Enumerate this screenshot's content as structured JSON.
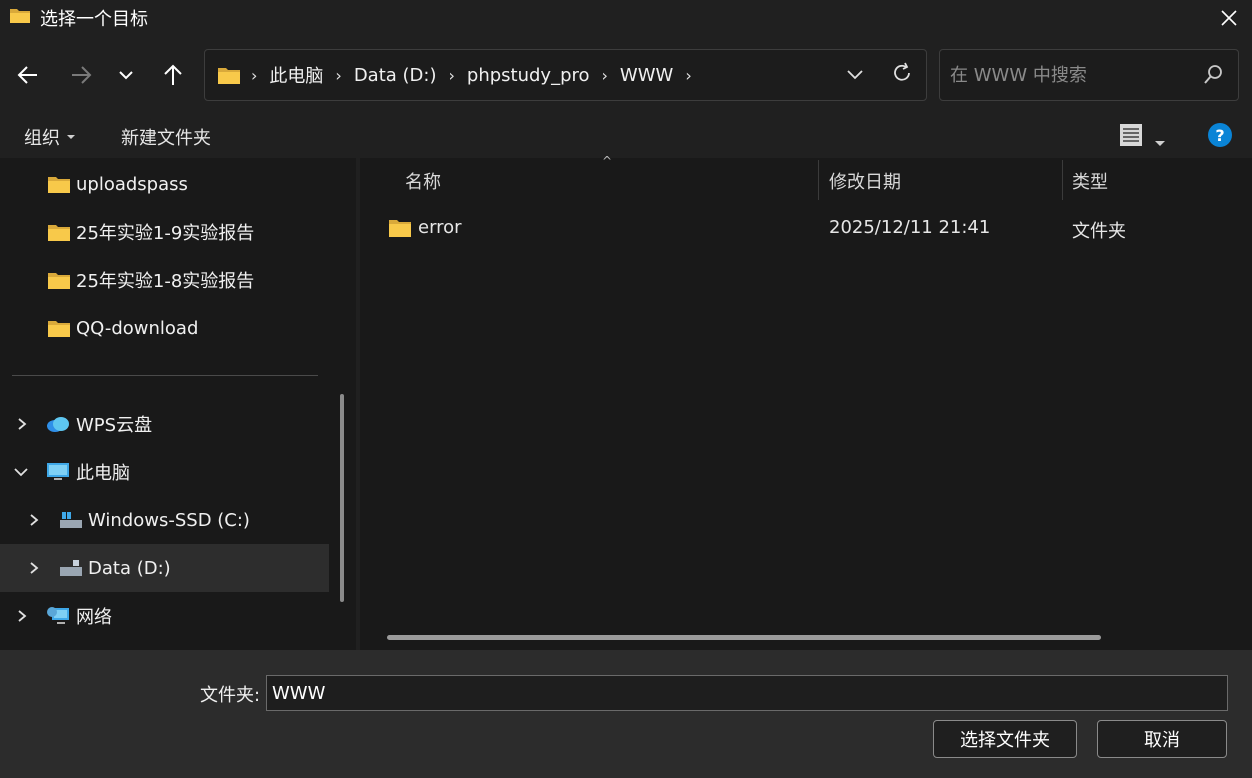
{
  "window": {
    "title": "选择一个目标"
  },
  "address": {
    "crumbs": [
      "此电脑",
      "Data (D:)",
      "phpstudy_pro",
      "WWW"
    ]
  },
  "search": {
    "placeholder": "在 WWW 中搜索"
  },
  "commands": {
    "organize": "组织",
    "new_folder": "新建文件夹"
  },
  "nav": {
    "folders": [
      "uploadspass",
      "25年实验1-9实验报告",
      "25年实验1-8实验报告",
      "QQ-download"
    ],
    "wps": "WPS云盘",
    "this_pc": "此电脑",
    "drive_c": "Windows-SSD (C:)",
    "drive_d": "Data (D:)",
    "network": "网络"
  },
  "columns": {
    "name": "名称",
    "modified": "修改日期",
    "type": "类型"
  },
  "files": [
    {
      "name": "error",
      "modified": "2025/12/11 21:41",
      "type": "文件夹"
    }
  ],
  "bottom": {
    "folder_label": "文件夹:",
    "folder_value": "WWW",
    "select_button": "选择文件夹",
    "cancel_button": "取消"
  },
  "colors": {
    "folder": "#f8c94a",
    "accent": "#0a84d6"
  }
}
